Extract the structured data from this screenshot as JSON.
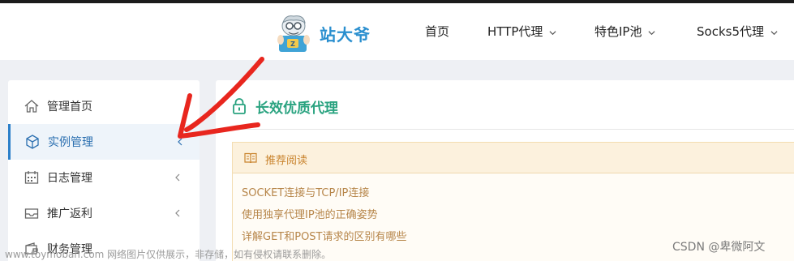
{
  "header": {
    "brand": "站大爷",
    "nav": [
      {
        "label": "首页",
        "has_dropdown": false
      },
      {
        "label": "HTTP代理",
        "has_dropdown": true
      },
      {
        "label": "特色IP池",
        "has_dropdown": true
      },
      {
        "label": "Socks5代理",
        "has_dropdown": true
      }
    ]
  },
  "sidebar": {
    "items": [
      {
        "label": "管理首页",
        "icon": "home-icon",
        "active": false,
        "expandable": false
      },
      {
        "label": "实例管理",
        "icon": "cube-icon",
        "active": true,
        "expandable": true
      },
      {
        "label": "日志管理",
        "icon": "calendar-icon",
        "active": false,
        "expandable": true
      },
      {
        "label": "推广返利",
        "icon": "inbox-icon",
        "active": false,
        "expandable": true
      },
      {
        "label": "财务管理",
        "icon": "wallet-icon",
        "active": false,
        "expandable": true
      }
    ]
  },
  "main": {
    "title": "长效优质代理",
    "notice": {
      "title": "推荐阅读",
      "links": [
        "SOCKET连接与TCP/IP连接",
        "使用独享代理IP池的正确姿势",
        "详解GET和POST请求的区别有哪些"
      ]
    }
  },
  "watermarks": {
    "left": "www.toymoban.com 网络图片仅供展示，非存储，如有侵权请联系删除。",
    "right": "CSDN @卑微阿文"
  },
  "colors": {
    "brand": "#2a8fcf",
    "accent_green": "#2aa380",
    "active_border": "#2b7fc9",
    "notice_text": "#c9842e",
    "annotation_red": "#e8261e"
  }
}
